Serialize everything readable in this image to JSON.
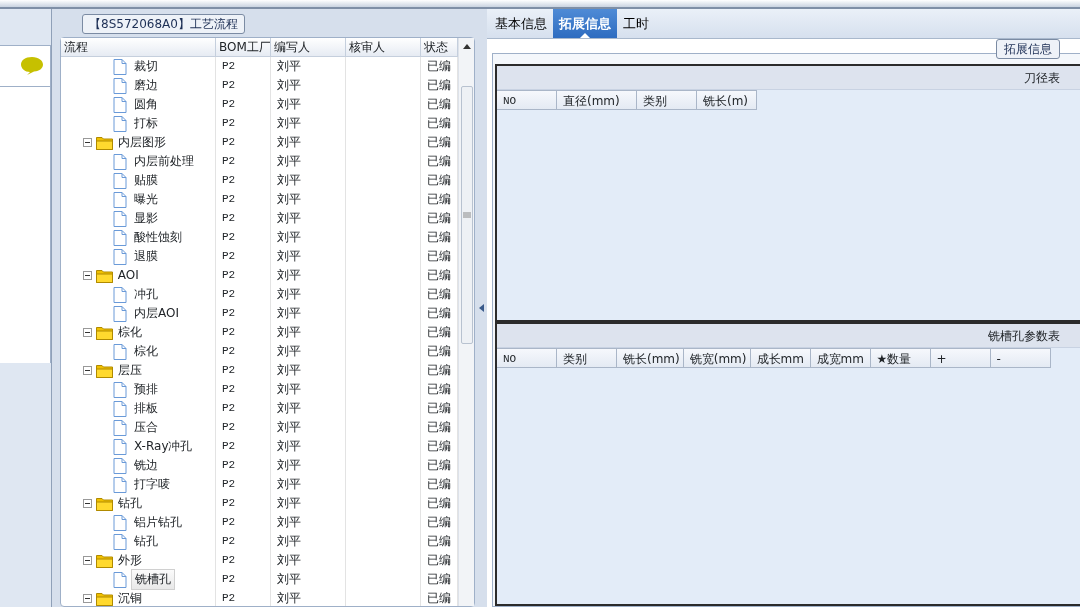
{
  "process_panel": {
    "title": "【8S572068A0】工艺流程",
    "columns": [
      "流程",
      "BOM工厂",
      "编写人",
      "核审人",
      "状态"
    ],
    "tree": [
      {
        "kind": "file",
        "label": "裁切",
        "bom": "P2",
        "author": "刘平",
        "status": "已编",
        "selected": false
      },
      {
        "kind": "file",
        "label": "磨边",
        "bom": "P2",
        "author": "刘平",
        "status": "已编",
        "selected": false
      },
      {
        "kind": "file",
        "label": "圆角",
        "bom": "P2",
        "author": "刘平",
        "status": "已编",
        "selected": false
      },
      {
        "kind": "file",
        "label": "打标",
        "bom": "P2",
        "author": "刘平",
        "status": "已编",
        "selected": false
      },
      {
        "kind": "folder",
        "label": "内层图形",
        "bom": "P2",
        "author": "刘平",
        "status": "已编",
        "selected": false,
        "expanded": true,
        "children": [
          {
            "kind": "file",
            "label": "内层前处理",
            "bom": "P2",
            "author": "刘平",
            "status": "已编",
            "selected": false
          },
          {
            "kind": "file",
            "label": "贴膜",
            "bom": "P2",
            "author": "刘平",
            "status": "已编",
            "selected": false
          },
          {
            "kind": "file",
            "label": "曝光",
            "bom": "P2",
            "author": "刘平",
            "status": "已编",
            "selected": false
          },
          {
            "kind": "file",
            "label": "显影",
            "bom": "P2",
            "author": "刘平",
            "status": "已编",
            "selected": false
          },
          {
            "kind": "file",
            "label": "酸性蚀刻",
            "bom": "P2",
            "author": "刘平",
            "status": "已编",
            "selected": false
          },
          {
            "kind": "file",
            "label": "退膜",
            "bom": "P2",
            "author": "刘平",
            "status": "已编",
            "selected": false
          }
        ]
      },
      {
        "kind": "folder",
        "label": "AOI",
        "bom": "P2",
        "author": "刘平",
        "status": "已编",
        "selected": false,
        "expanded": true,
        "children": [
          {
            "kind": "file",
            "label": "冲孔",
            "bom": "P2",
            "author": "刘平",
            "status": "已编",
            "selected": false
          },
          {
            "kind": "file",
            "label": "内层AOI",
            "bom": "P2",
            "author": "刘平",
            "status": "已编",
            "selected": false
          }
        ]
      },
      {
        "kind": "folder",
        "label": "棕化",
        "bom": "P2",
        "author": "刘平",
        "status": "已编",
        "selected": false,
        "expanded": true,
        "children": [
          {
            "kind": "file",
            "label": "棕化",
            "bom": "P2",
            "author": "刘平",
            "status": "已编",
            "selected": false
          }
        ]
      },
      {
        "kind": "folder",
        "label": "层压",
        "bom": "P2",
        "author": "刘平",
        "status": "已编",
        "selected": false,
        "expanded": true,
        "children": [
          {
            "kind": "file",
            "label": "预排",
            "bom": "P2",
            "author": "刘平",
            "status": "已编",
            "selected": false
          },
          {
            "kind": "file",
            "label": "排板",
            "bom": "P2",
            "author": "刘平",
            "status": "已编",
            "selected": false
          },
          {
            "kind": "file",
            "label": "压合",
            "bom": "P2",
            "author": "刘平",
            "status": "已编",
            "selected": false
          },
          {
            "kind": "file",
            "label": "X-Ray冲孔",
            "bom": "P2",
            "author": "刘平",
            "status": "已编",
            "selected": false
          },
          {
            "kind": "file",
            "label": "铣边",
            "bom": "P2",
            "author": "刘平",
            "status": "已编",
            "selected": false
          },
          {
            "kind": "file",
            "label": "打字唛",
            "bom": "P2",
            "author": "刘平",
            "status": "已编",
            "selected": false
          }
        ]
      },
      {
        "kind": "folder",
        "label": "钻孔",
        "bom": "P2",
        "author": "刘平",
        "status": "已编",
        "selected": false,
        "expanded": true,
        "children": [
          {
            "kind": "file",
            "label": "铝片钻孔",
            "bom": "P2",
            "author": "刘平",
            "status": "已编",
            "selected": false
          },
          {
            "kind": "file",
            "label": "钻孔",
            "bom": "P2",
            "author": "刘平",
            "status": "已编",
            "selected": false
          }
        ]
      },
      {
        "kind": "folder",
        "label": "外形",
        "bom": "P2",
        "author": "刘平",
        "status": "已编",
        "selected": false,
        "expanded": true,
        "children": [
          {
            "kind": "file",
            "label": "铣槽孔",
            "bom": "P2",
            "author": "刘平",
            "status": "已编",
            "selected": true
          }
        ]
      },
      {
        "kind": "folder",
        "label": "沉铜",
        "bom": "P2",
        "author": "刘平",
        "status": "已编",
        "selected": false,
        "expanded": true
      }
    ]
  },
  "tabs": [
    {
      "label": "基本信息",
      "selected": false
    },
    {
      "label": "拓展信息",
      "selected": true
    },
    {
      "label": "工时",
      "selected": false
    }
  ],
  "extension_group": {
    "title": "拓展信息",
    "grids": [
      {
        "title": "刀径表",
        "columns": [
          "NO",
          "直径(mm)",
          "类别",
          "铣长(m)"
        ]
      },
      {
        "title": "铣槽孔参数表",
        "columns": [
          "NO",
          "类别",
          "铣长(mm)",
          "铣宽(mm)",
          "成长mm",
          "成宽mm",
          "★数量",
          "+",
          "-"
        ]
      }
    ]
  }
}
